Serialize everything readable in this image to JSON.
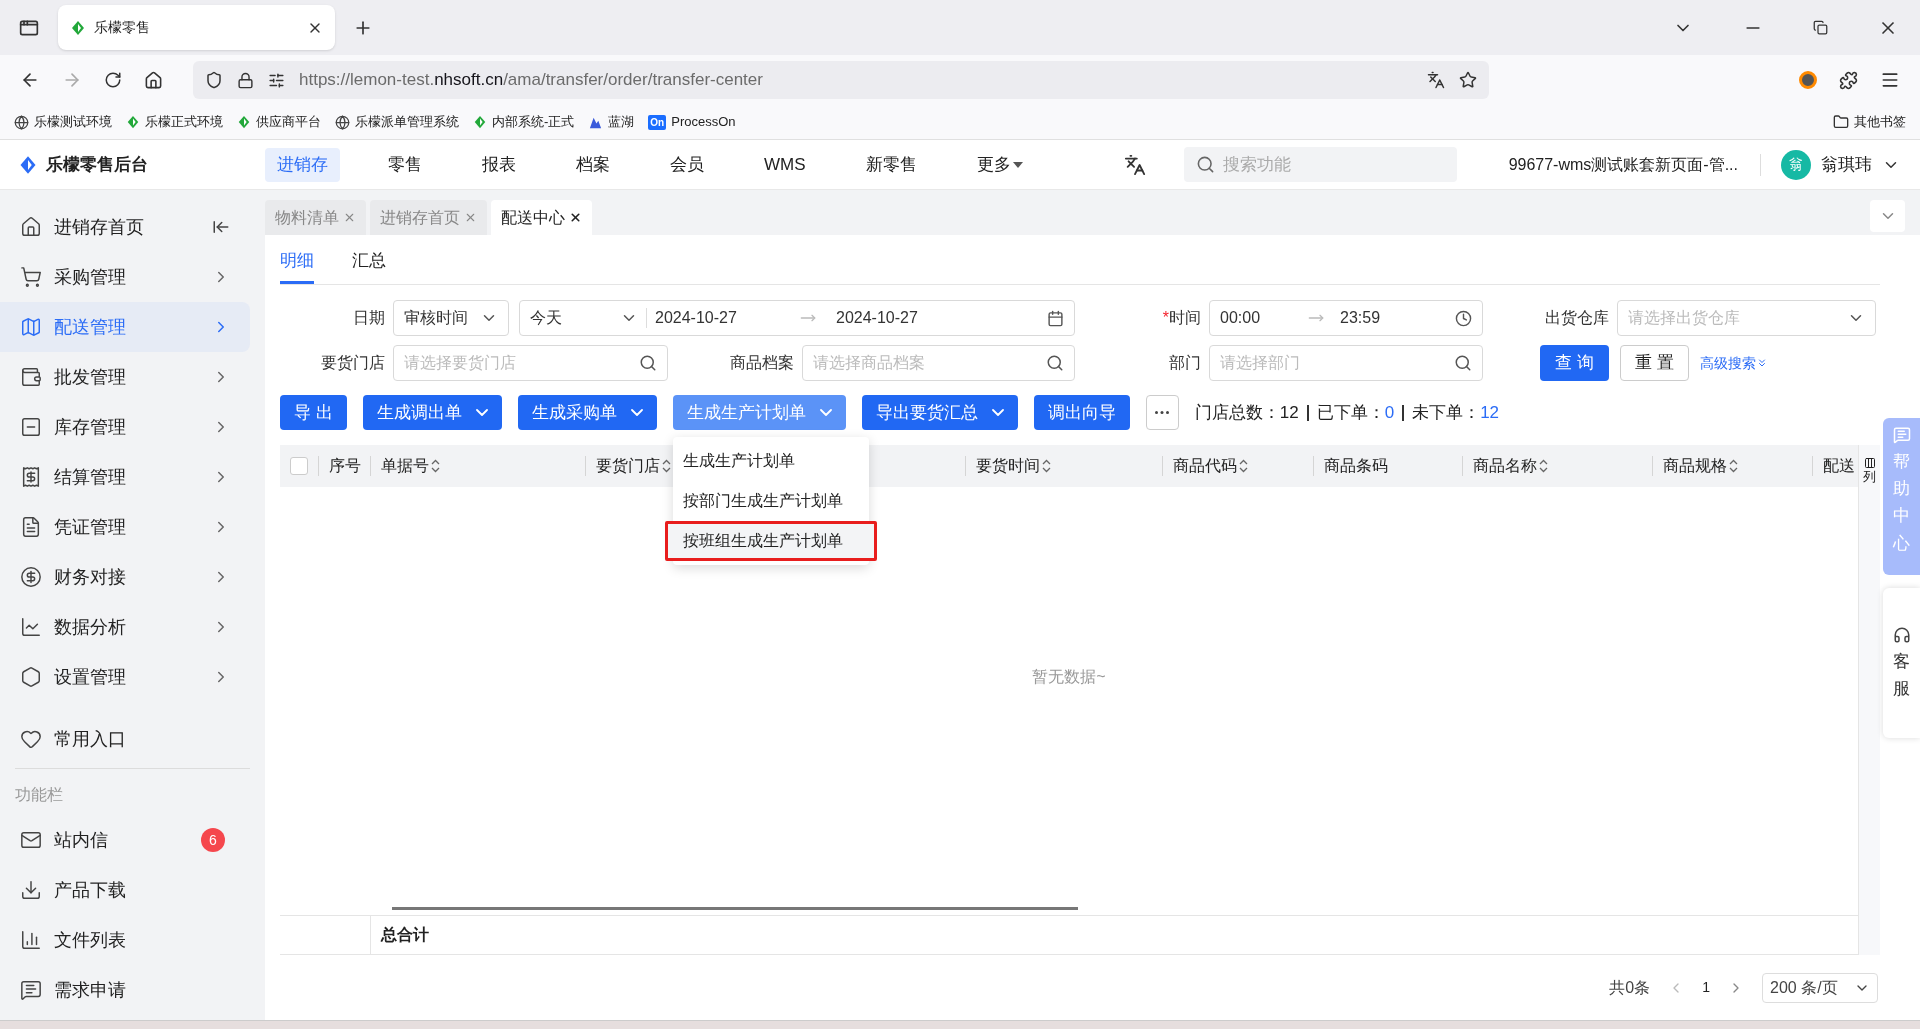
{
  "browser": {
    "tab": {
      "title": "乐檬零售"
    },
    "url": "https://lemon-test.**nhsoft.cn**/ama/transfer/order/transfer-center",
    "bookmarks": [
      {
        "label": "乐檬测试环境",
        "kind": "globe"
      },
      {
        "label": "乐檬正式环境",
        "kind": "leaf"
      },
      {
        "label": "供应商平台",
        "kind": "leaf"
      },
      {
        "label": "乐檬派单管理系统",
        "kind": "globe"
      },
      {
        "label": "内部系统-正式",
        "kind": "leaf"
      },
      {
        "label": "蓝湖",
        "kind": "lake"
      },
      {
        "label": "ProcessOn",
        "kind": "badge",
        "badge": "On"
      }
    ],
    "other_bookmarks": "其他书签"
  },
  "header": {
    "brand": "乐檬零售后台",
    "nav": [
      {
        "label": "进销存",
        "selected": true,
        "kind": "link"
      },
      {
        "label": "零售",
        "selected": false,
        "kind": "link"
      },
      {
        "label": "报表",
        "selected": false,
        "kind": "link"
      },
      {
        "label": "档案",
        "selected": false,
        "kind": "link"
      },
      {
        "label": "会员",
        "selected": false,
        "kind": "link"
      },
      {
        "label": "WMS",
        "selected": false,
        "kind": "link"
      },
      {
        "label": "新零售",
        "selected": false,
        "kind": "link"
      },
      {
        "label": "更多",
        "selected": false,
        "kind": "menu"
      }
    ],
    "search": {
      "placeholder": "搜索功能"
    },
    "account": "99677-wms测试账套新页面-管...",
    "avatar_text": "翁",
    "user": "翁琪玮"
  },
  "sidebar": {
    "items": [
      {
        "label": "进销存首页",
        "selected": false,
        "kind": "home"
      },
      {
        "label": "采购管理",
        "selected": false,
        "kind": "menu"
      },
      {
        "label": "配送管理",
        "selected": true,
        "kind": "menu"
      },
      {
        "label": "批发管理",
        "selected": false,
        "kind": "menu"
      },
      {
        "label": "库存管理",
        "selected": false,
        "kind": "menu"
      },
      {
        "label": "结算管理",
        "selected": false,
        "kind": "menu"
      },
      {
        "label": "凭证管理",
        "selected": false,
        "kind": "menu"
      },
      {
        "label": "财务对接",
        "selected": false,
        "kind": "menu"
      },
      {
        "label": "数据分析",
        "selected": false,
        "kind": "menu"
      },
      {
        "label": "设置管理",
        "selected": false,
        "kind": "menu"
      }
    ],
    "favorites": "常用入口",
    "section_label": "功能栏",
    "tools": [
      {
        "label": "站内信",
        "badge": "6"
      },
      {
        "label": "产品下载"
      },
      {
        "label": "文件列表"
      },
      {
        "label": "需求申请"
      }
    ]
  },
  "page_tabs": [
    {
      "label": "物料清单",
      "selected": false
    },
    {
      "label": "进销存首页",
      "selected": false
    },
    {
      "label": "配送中心",
      "selected": true
    }
  ],
  "sub_tabs": [
    {
      "label": "明细",
      "selected": true
    },
    {
      "label": "汇总",
      "selected": false
    }
  ],
  "filters": {
    "date": {
      "label": "日期",
      "type": "审核时间",
      "preset": "今天",
      "start": "2024-10-27",
      "end": "2024-10-27"
    },
    "time": {
      "label": "时间",
      "required_mark": "*",
      "start": "00:00",
      "end": "23:59"
    },
    "warehouse": {
      "label": "出货仓库",
      "placeholder": "请选择出货仓库"
    },
    "store": {
      "label": "要货门店",
      "placeholder": "请选择要货门店"
    },
    "product": {
      "label": "商品档案",
      "placeholder": "请选择商品档案"
    },
    "department": {
      "label": "部门",
      "placeholder": "请选择部门"
    },
    "query_button": "查 询",
    "reset_button": "重 置",
    "advanced_link": "高级搜索"
  },
  "toolbar": {
    "buttons": [
      {
        "label": "导 出",
        "dropdown": false,
        "expanded": false
      },
      {
        "label": "生成调出单",
        "dropdown": true,
        "expanded": false
      },
      {
        "label": "生成采购单",
        "dropdown": true,
        "expanded": false
      },
      {
        "label": "生成生产计划单",
        "dropdown": true,
        "expanded": true
      },
      {
        "label": "导出要货汇总",
        "dropdown": true,
        "expanded": false
      },
      {
        "label": "调出向导",
        "dropdown": false,
        "expanded": false
      }
    ],
    "stats": [
      {
        "label": "门店总数：",
        "value": "12",
        "kind": "total"
      },
      {
        "label": "已下单：",
        "value": "0",
        "kind": "count"
      },
      {
        "label": "未下单：",
        "value": "12",
        "kind": "count"
      }
    ],
    "menu": [
      {
        "label": "生成生产计划单",
        "selected": false
      },
      {
        "label": "按部门生成生产计划单",
        "selected": false
      },
      {
        "label": "按班组生成生产计划单",
        "selected": true
      }
    ]
  },
  "table": {
    "select_all": {
      "checked": false
    },
    "columns": [
      {
        "label": "序号",
        "sortable": false
      },
      {
        "label": "单据号",
        "sortable": true
      },
      {
        "label": "要货门店",
        "sortable": true
      },
      {
        "label": "要货时间",
        "sortable": true
      },
      {
        "label": "商品代码",
        "sortable": true
      },
      {
        "label": "商品条码",
        "sortable": false
      },
      {
        "label": "商品名称",
        "sortable": true
      },
      {
        "label": "商品规格",
        "sortable": true
      },
      {
        "label": "配送",
        "sortable": false
      }
    ],
    "column_settings": "列",
    "empty_text": "暂无数据~",
    "total_label": "总合计"
  },
  "pagination": {
    "total": "共0条",
    "page": "1",
    "page_size": "200 条/页"
  },
  "floating": {
    "help": "帮助中心",
    "service": "客服"
  }
}
